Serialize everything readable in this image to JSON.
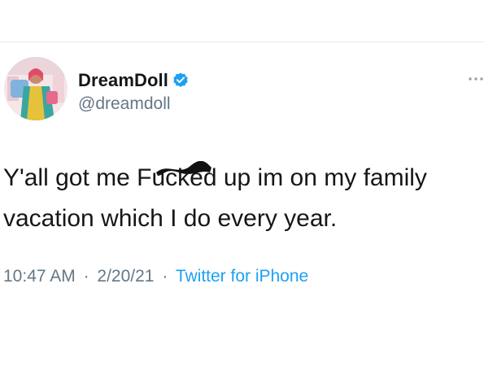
{
  "user": {
    "display_name": "DreamDoll",
    "handle": "@dreamdoll",
    "verified": true,
    "verified_badge_color": "#1da1f2"
  },
  "tweet": {
    "text": "Y'all got me Fucked up im on my family vacation which I do every year.",
    "redacted_word": "Fucked"
  },
  "meta": {
    "time": "10:47 AM",
    "date": "2/20/21",
    "source": "Twitter for iPhone",
    "separator": "·"
  },
  "icons": {
    "more": "more-dots-icon",
    "verified": "verified-badge-icon"
  },
  "colors": {
    "text": "#14171a",
    "secondary": "#657786",
    "link": "#1da1f2",
    "divider": "#e6ecf0"
  }
}
